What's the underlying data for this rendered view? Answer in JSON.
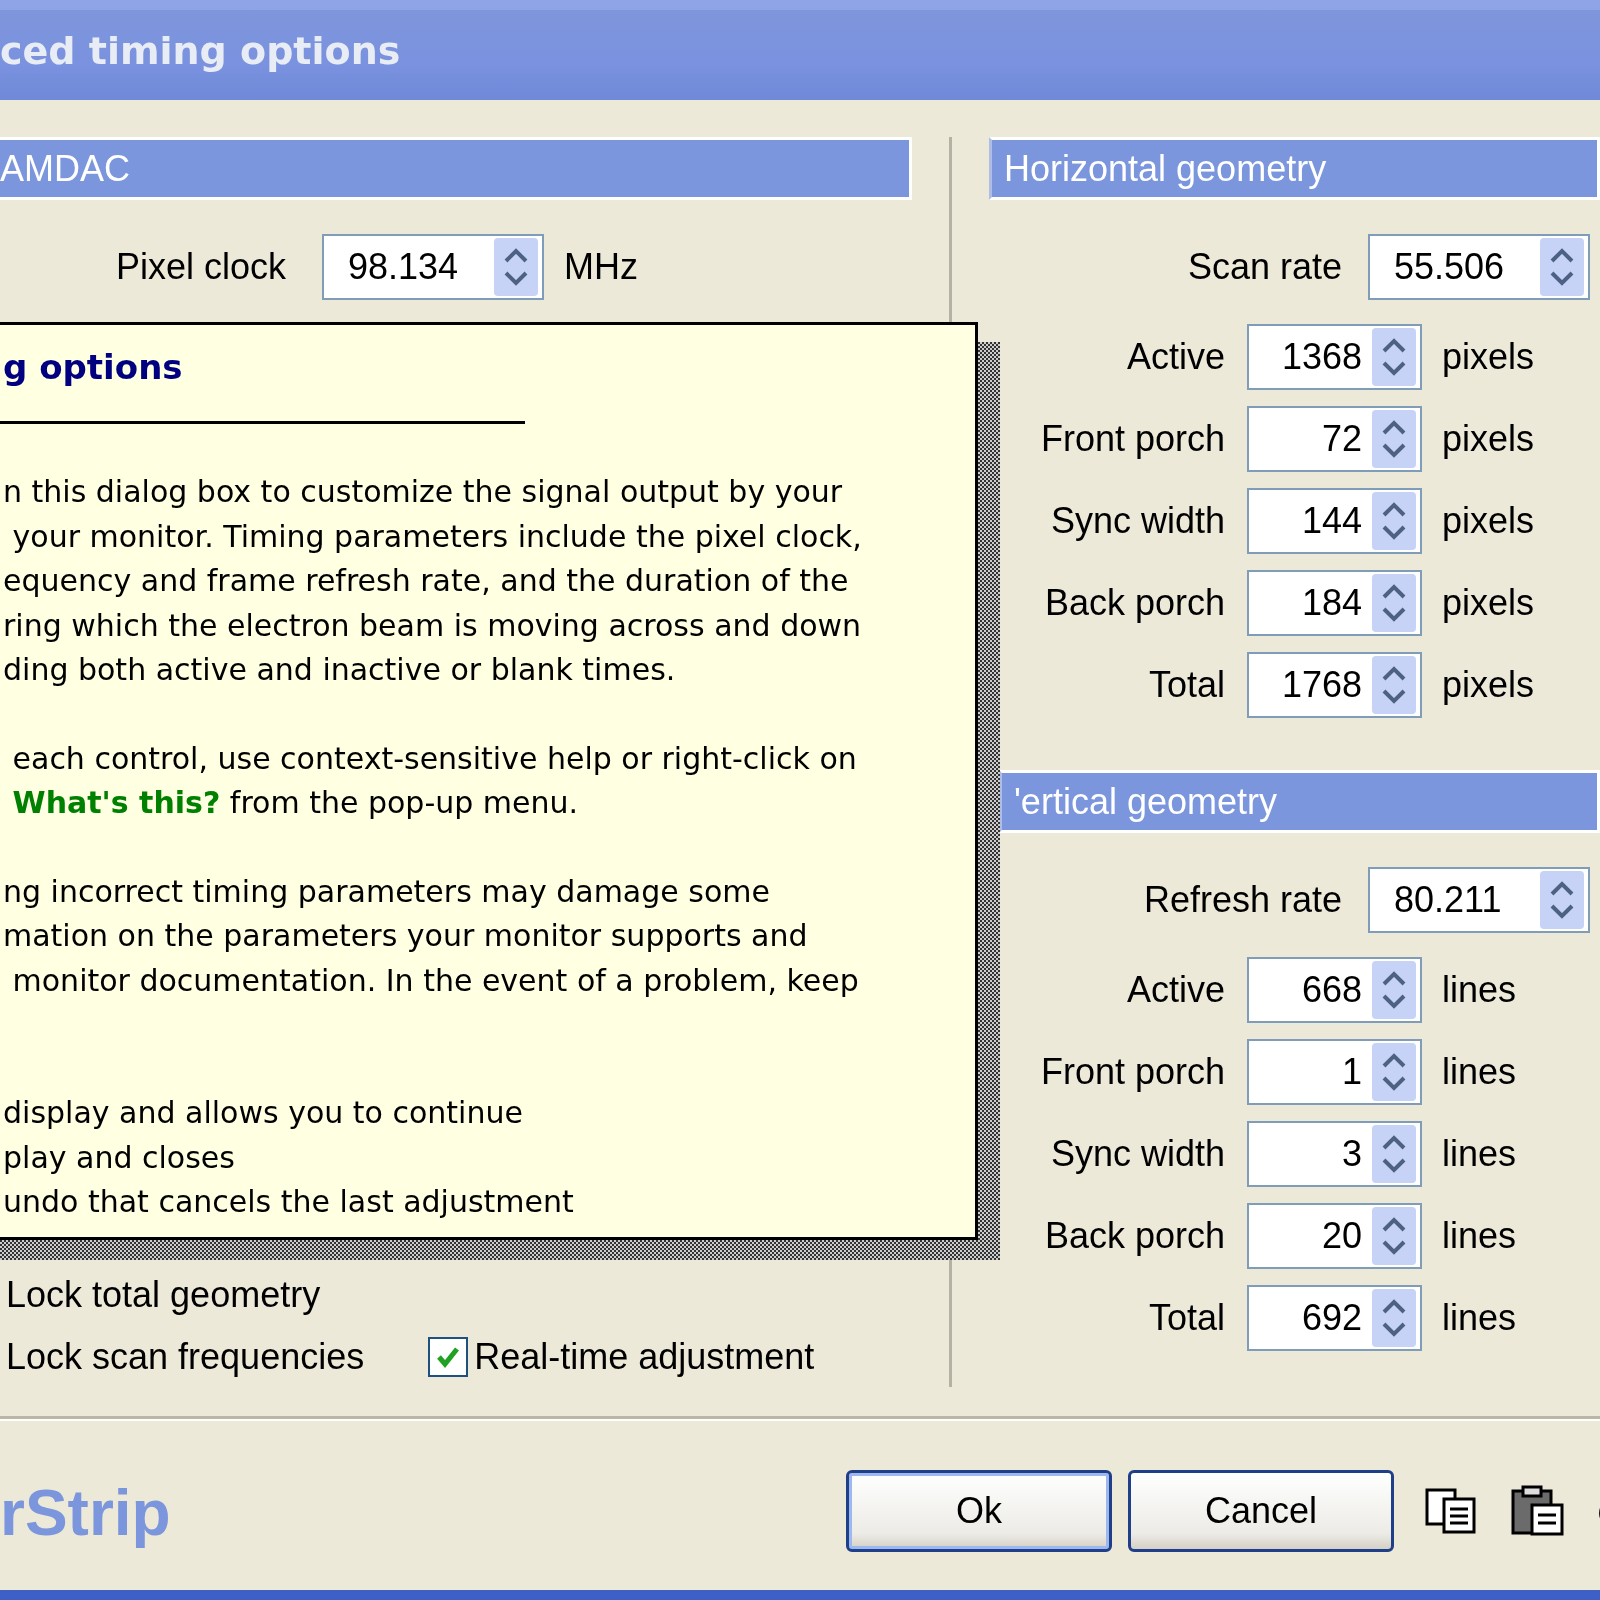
{
  "window": {
    "title": "ced timing options"
  },
  "ramdac": {
    "header": "AMDAC",
    "pixel_clock": {
      "label": "Pixel clock",
      "value": "98.134",
      "unit": "MHz"
    },
    "options": [
      [
        {
          "kind": "label",
          "label": "Lock total geometry"
        }
      ],
      [
        {
          "kind": "label",
          "label": "Lock scan frequencies"
        },
        {
          "kind": "checkbox",
          "label": "Real-time adjustment",
          "checked": true
        }
      ]
    ]
  },
  "horizontal": {
    "header": "Horizontal geometry",
    "rate": {
      "label": "Scan rate",
      "value": "55.506"
    },
    "rows": [
      {
        "label": "Active",
        "value": "1368",
        "unit": "pixels"
      },
      {
        "label": "Front porch",
        "value": "72",
        "unit": "pixels"
      },
      {
        "label": "Sync width",
        "value": "144",
        "unit": "pixels"
      },
      {
        "label": "Back porch",
        "value": "184",
        "unit": "pixels"
      },
      {
        "label": "Total",
        "value": "1768",
        "unit": "pixels"
      }
    ]
  },
  "vertical": {
    "header": "'ertical geometry",
    "rate": {
      "label": "Refresh rate",
      "value": "80.211"
    },
    "rows": [
      {
        "label": "Active",
        "value": "668",
        "unit": "lines"
      },
      {
        "label": "Front porch",
        "value": "1",
        "unit": "lines"
      },
      {
        "label": "Sync width",
        "value": "3",
        "unit": "lines"
      },
      {
        "label": "Back porch",
        "value": "20",
        "unit": "lines"
      },
      {
        "label": "Total",
        "value": "692",
        "unit": "lines"
      }
    ]
  },
  "help_popup": {
    "title": "g options",
    "paragraphs": [
      [
        "n this dialog box to customize the signal output by your",
        " your monitor. Timing parameters include the pixel clock,",
        "equency and frame refresh rate, and the duration of the",
        "ring which the electron beam is moving across and down",
        "ding both active and inactive or blank times."
      ],
      [
        " each control, use context-sensitive help or right-click on",
        " **What's this?** from the pop-up menu."
      ],
      [
        "ng incorrect timing parameters may damage some",
        "mation on the parameters your monitor supports and",
        " monitor documentation. In the event of a problem, keep"
      ],
      [
        "display and allows you to continue",
        "play and closes",
        "undo that cancels the last adjustment"
      ]
    ]
  },
  "footer": {
    "logo": "rStrip",
    "buttons": [
      {
        "label": "Ok",
        "default": true
      },
      {
        "label": "Cancel",
        "default": false
      }
    ]
  }
}
